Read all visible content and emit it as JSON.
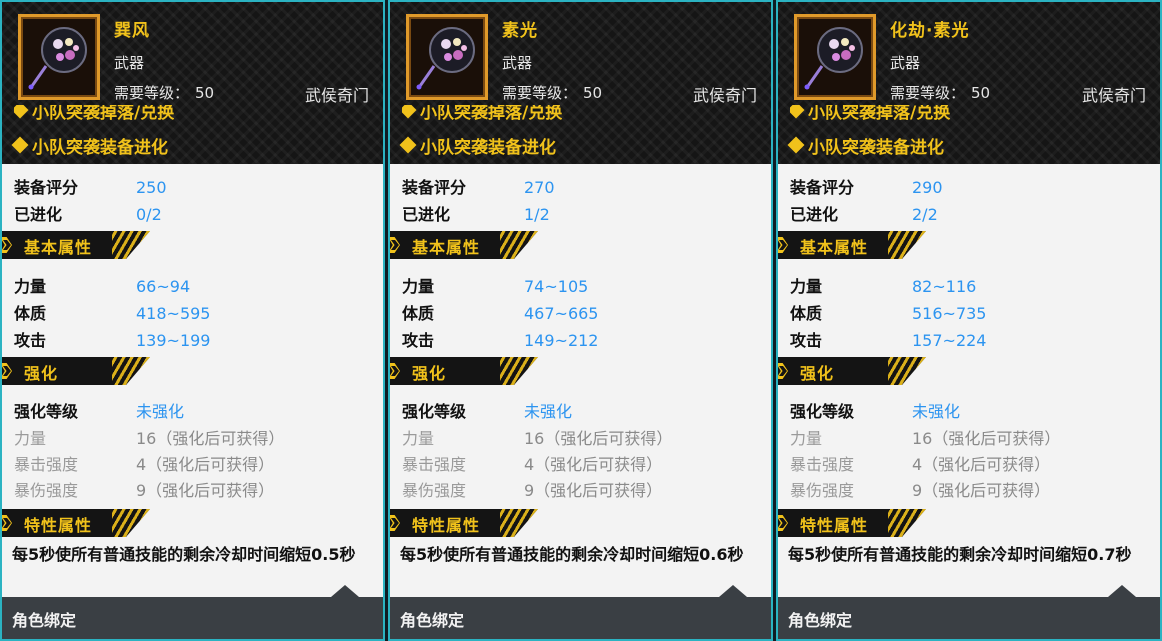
{
  "panels": [
    {
      "name": "巽风",
      "type": "武器",
      "req_label": "需要等级：",
      "req_value": "50",
      "class": "武侯奇门",
      "sources": [
        "小队突袭掉落/兑换",
        "小队突袭装备进化"
      ],
      "rating_label": "装备评分",
      "rating_value": "250",
      "evolved_label": "已进化",
      "evolved_value": "0/2",
      "basic_title": "基本属性",
      "basic": [
        {
          "label": "力量",
          "value": "66~94"
        },
        {
          "label": "体质",
          "value": "418~595"
        },
        {
          "label": "攻击",
          "value": "139~199"
        }
      ],
      "enhance_title": "强化",
      "enhance_level_label": "强化等级",
      "enhance_level_value": "未强化",
      "enhance": [
        {
          "label": "力量",
          "value": "16（强化后可获得）"
        },
        {
          "label": "暴击强度",
          "value": "4（强化后可获得）"
        },
        {
          "label": "暴伤强度",
          "value": "9（强化后可获得）"
        }
      ],
      "trait_title": "特性属性",
      "trait_text": "每5秒使所有普通技能的剩余冷却时间缩短0.5秒",
      "bind": "角色绑定"
    },
    {
      "name": "素光",
      "type": "武器",
      "req_label": "需要等级：",
      "req_value": "50",
      "class": "武侯奇门",
      "sources": [
        "小队突袭掉落/兑换",
        "小队突袭装备进化"
      ],
      "rating_label": "装备评分",
      "rating_value": "270",
      "evolved_label": "已进化",
      "evolved_value": "1/2",
      "basic_title": "基本属性",
      "basic": [
        {
          "label": "力量",
          "value": "74~105"
        },
        {
          "label": "体质",
          "value": "467~665"
        },
        {
          "label": "攻击",
          "value": "149~212"
        }
      ],
      "enhance_title": "强化",
      "enhance_level_label": "强化等级",
      "enhance_level_value": "未强化",
      "enhance": [
        {
          "label": "力量",
          "value": "16（强化后可获得）"
        },
        {
          "label": "暴击强度",
          "value": "4（强化后可获得）"
        },
        {
          "label": "暴伤强度",
          "value": "9（强化后可获得）"
        }
      ],
      "trait_title": "特性属性",
      "trait_text": "每5秒使所有普通技能的剩余冷却时间缩短0.6秒",
      "bind": "角色绑定"
    },
    {
      "name": "化劫·素光",
      "type": "武器",
      "req_label": "需要等级：",
      "req_value": "50",
      "class": "武侯奇门",
      "sources": [
        "小队突袭掉落/兑换",
        "小队突袭装备进化"
      ],
      "rating_label": "装备评分",
      "rating_value": "290",
      "evolved_label": "已进化",
      "evolved_value": "2/2",
      "basic_title": "基本属性",
      "basic": [
        {
          "label": "力量",
          "value": "82~116"
        },
        {
          "label": "体质",
          "value": "516~735"
        },
        {
          "label": "攻击",
          "value": "157~224"
        }
      ],
      "enhance_title": "强化",
      "enhance_level_label": "强化等级",
      "enhance_level_value": "未强化",
      "enhance": [
        {
          "label": "力量",
          "value": "16（强化后可获得）"
        },
        {
          "label": "暴击强度",
          "value": "4（强化后可获得）"
        },
        {
          "label": "暴伤强度",
          "value": "9（强化后可获得）"
        }
      ],
      "trait_title": "特性属性",
      "trait_text": "每5秒使所有普通技能的剩余冷却时间缩短0.7秒",
      "bind": "角色绑定"
    }
  ],
  "colors": {
    "accent": "#f1c21b",
    "value_blue": "#2c94f0",
    "border": "#2bb3c2",
    "icon_frame": "#e09a2a"
  },
  "icons": {
    "item_icon": "fan-weapon-icon",
    "source_bullet": "diamond-icon",
    "section_marker": "chevron-right-icon"
  }
}
